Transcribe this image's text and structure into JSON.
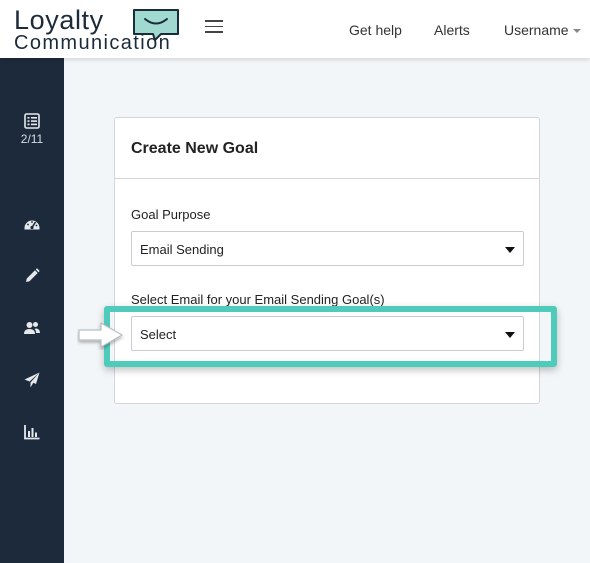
{
  "header": {
    "logo": {
      "line1": "Loyalty",
      "line2": "Communication"
    },
    "nav": {
      "help": "Get help",
      "alerts": "Alerts",
      "user": "Username"
    }
  },
  "sidebar": {
    "items": [
      {
        "icon": "list-icon",
        "count": "2/11"
      },
      {
        "icon": "dashboard-icon"
      },
      {
        "icon": "pencil-icon"
      },
      {
        "icon": "users-icon"
      },
      {
        "icon": "paper-plane-icon"
      },
      {
        "icon": "bar-chart-icon"
      }
    ]
  },
  "card": {
    "title": "Create New Goal",
    "goal_purpose": {
      "label": "Goal Purpose",
      "value": "Email Sending"
    },
    "email_select": {
      "label": "Select Email for your Email Sending Goal(s)",
      "value": "Select"
    }
  },
  "colors": {
    "sidebar": "#1c2a3c",
    "highlight": "#4ecbbb",
    "logo_bubble": "#9fd9d0"
  }
}
